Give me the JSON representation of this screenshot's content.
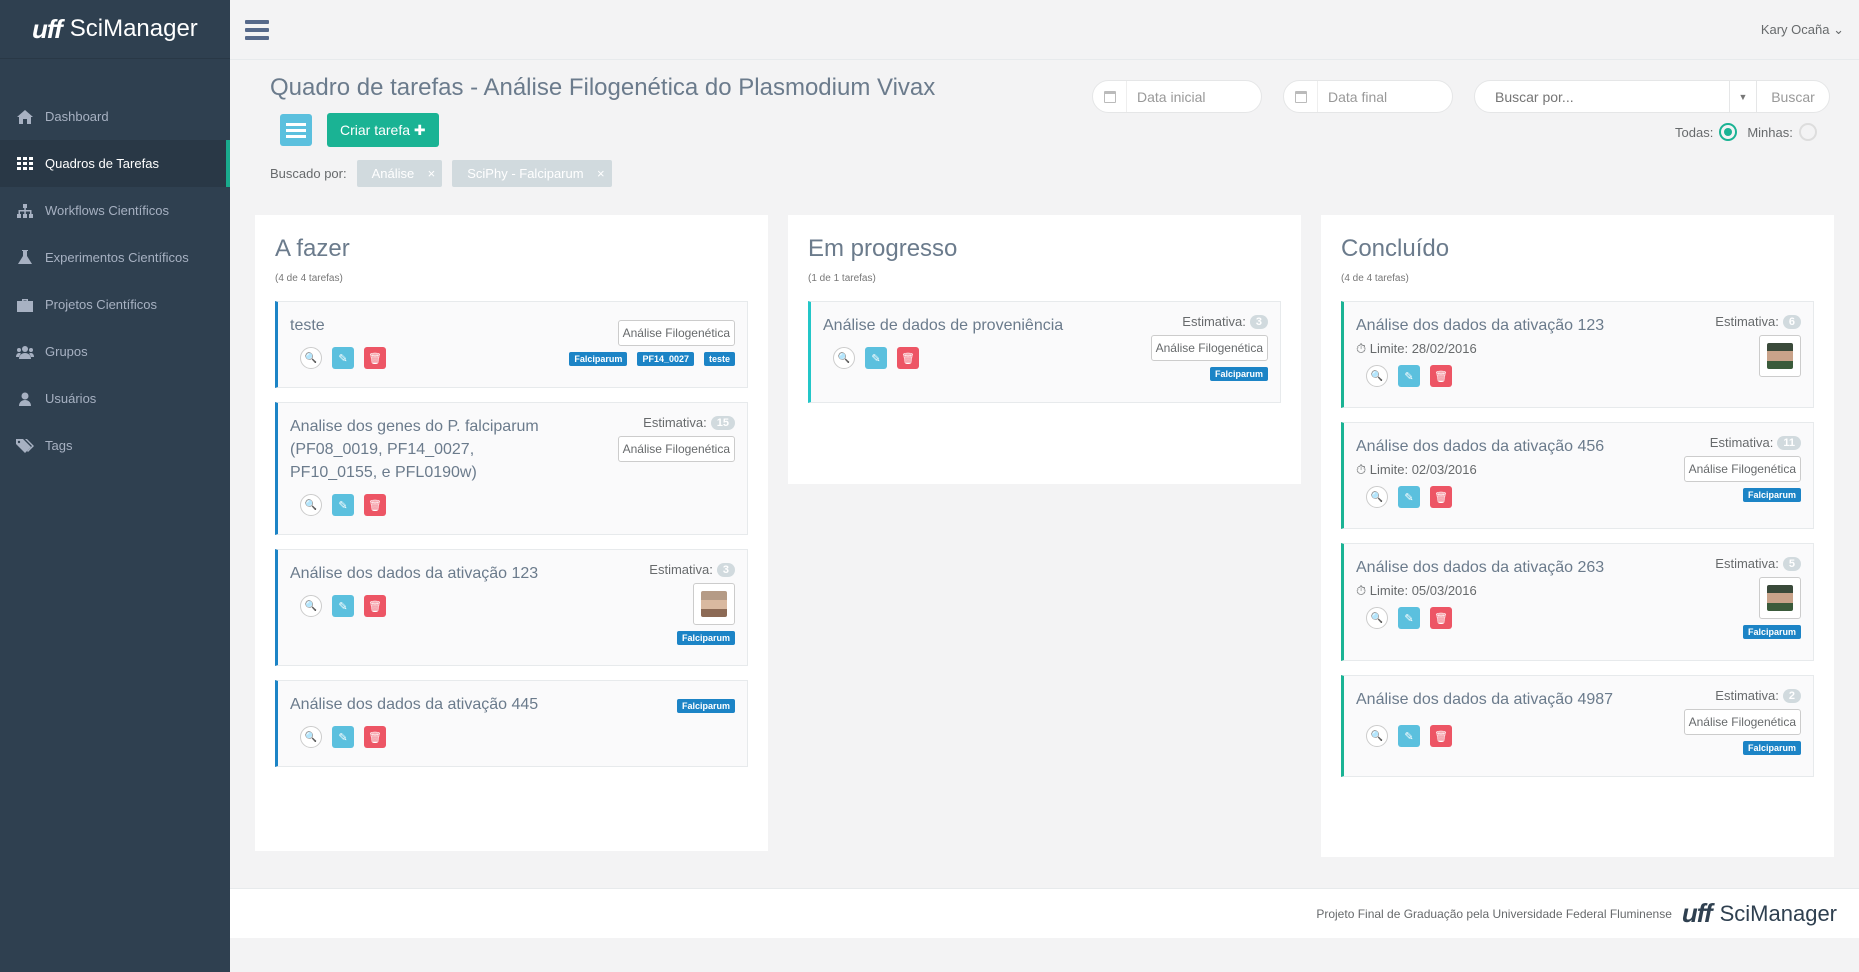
{
  "app": {
    "brand_prefix": "uff",
    "brand_name": "SciManager"
  },
  "sidebar": {
    "items": [
      {
        "label": "Dashboard",
        "icon": "home-icon",
        "active": false
      },
      {
        "label": "Quadros de Tarefas",
        "icon": "grid-icon",
        "active": true
      },
      {
        "label": "Workflows Científicos",
        "icon": "sitemap-icon",
        "active": false
      },
      {
        "label": "Experimentos Científicos",
        "icon": "flask-icon",
        "active": false
      },
      {
        "label": "Projetos Científicos",
        "icon": "briefcase-icon",
        "active": false
      },
      {
        "label": "Grupos",
        "icon": "users-icon",
        "active": false
      },
      {
        "label": "Usuários",
        "icon": "user-icon",
        "active": false
      },
      {
        "label": "Tags",
        "icon": "tags-icon",
        "active": false
      }
    ]
  },
  "topbar": {
    "user_name": "Kary Ocaña",
    "user_caret": "⌄"
  },
  "page": {
    "title": "Quadro de tarefas - Análise Filogenética do Plasmodium Vivax",
    "create_button": "Criar tarefa",
    "create_icon": "✚",
    "filter_label": "Buscado por:",
    "filters": [
      "Análise",
      "SciPhy - Falciparum"
    ],
    "filter_remove": "×"
  },
  "search": {
    "date_start_placeholder": "Data inicial",
    "date_end_placeholder": "Data final",
    "query_placeholder": "Buscar por...",
    "button": "Buscar",
    "scope_all": "Todas:",
    "scope_mine": "Minhas:"
  },
  "estimate_label": "Estimativa:",
  "limit_label": "Limite:",
  "columns": [
    {
      "title": "A fazer",
      "count": "(4 de 4 tarefas)",
      "cards": [
        {
          "title": "teste",
          "tag": "Análise Filogenética",
          "labels": [
            "Falciparum",
            "PF14_0027",
            "teste"
          ]
        },
        {
          "title": "Analise dos genes do P. falciparum (PF08_0019, PF14_0027, PF10_0155, e PFL0190w)",
          "estimate": "15",
          "tag": "Análise Filogenética"
        },
        {
          "title": "Análise dos dados da ativação 123",
          "estimate": "3",
          "labels": [
            "Falciparum"
          ],
          "avatar": "female-avatar"
        },
        {
          "title": "Análise dos dados da ativação 445",
          "labels": [
            "Falciparum"
          ]
        }
      ]
    },
    {
      "title": "Em progresso",
      "count": "(1 de 1 tarefas)",
      "cards": [
        {
          "title": "Análise de dados de proveniência",
          "estimate": "3",
          "tag": "Análise Filogenética",
          "labels": [
            "Falciparum"
          ]
        }
      ]
    },
    {
      "title": "Concluído",
      "count": "(4 de 4 tarefas)",
      "cards": [
        {
          "title": "Análise dos dados da ativação 123",
          "estimate": "6",
          "limit": "28/02/2016",
          "avatar": "male-avatar"
        },
        {
          "title": "Análise dos dados da ativação 456",
          "estimate": "11",
          "limit": "02/03/2016",
          "tag": "Análise Filogenética",
          "labels": [
            "Falciparum"
          ]
        },
        {
          "title": "Análise dos dados da ativação 263",
          "estimate": "5",
          "limit": "05/03/2016",
          "avatar": "male-avatar",
          "labels": [
            "Falciparum"
          ]
        },
        {
          "title": "Análise dos dados da ativação 4987",
          "estimate": "2",
          "tag": "Análise Filogenética",
          "labels": [
            "Falciparum"
          ]
        }
      ]
    }
  ],
  "footer": {
    "text": "Projeto Final de Graduação pela Universidade Federal Fluminense",
    "brand_prefix": "uff",
    "brand_name": "SciManager"
  },
  "colors": {
    "sidebar": "#2f4050",
    "primary": "#1ab394",
    "info": "#5bc0de",
    "danger": "#ed5565",
    "label": "#1c84c6"
  }
}
